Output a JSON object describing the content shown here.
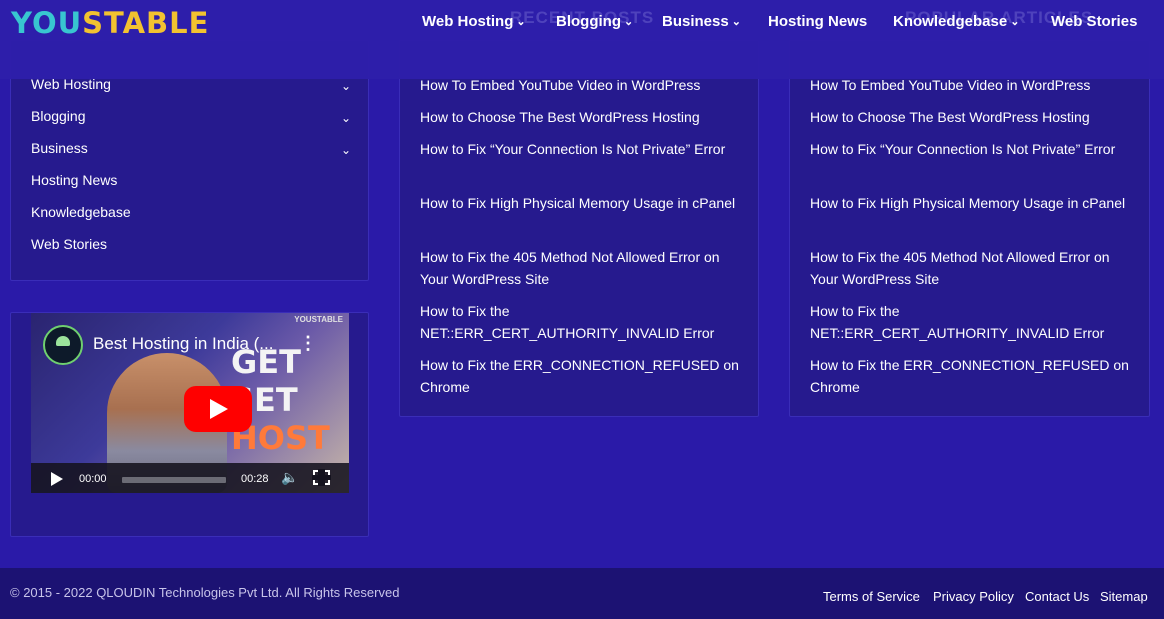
{
  "header": {
    "logo_part1": "YOU",
    "logo_part2": "STABLE",
    "ghost_recent": "RECENT POSTS",
    "ghost_popular": "POPULAR ARTICLES",
    "nav": [
      {
        "label": "Web Hosting",
        "has_dropdown": true
      },
      {
        "label": "Blogging",
        "has_dropdown": true
      },
      {
        "label": "Business",
        "has_dropdown": true
      },
      {
        "label": "Hosting News",
        "has_dropdown": false
      },
      {
        "label": "Knowledgebase",
        "has_dropdown": true
      },
      {
        "label": "Web Stories",
        "has_dropdown": false
      }
    ]
  },
  "categories": [
    {
      "label": "Web Hosting",
      "has_dropdown": true
    },
    {
      "label": "Blogging",
      "has_dropdown": true
    },
    {
      "label": "Business",
      "has_dropdown": true
    },
    {
      "label": "Hosting News",
      "has_dropdown": false
    },
    {
      "label": "Knowledgebase",
      "has_dropdown": false
    },
    {
      "label": "Web Stories",
      "has_dropdown": false
    }
  ],
  "video": {
    "title": "Best Hosting in India (...",
    "brand": "YOUSTABLE",
    "promo_line1": "GET",
    "promo_line2": "SET",
    "promo_line3": "HOST",
    "time_current": "00:00",
    "time_total": "00:28"
  },
  "recent_posts": [
    "How To Embed YouTube Video in WordPress",
    "How to Choose The Best WordPress Hosting",
    "How to Fix “Your Connection Is Not Private” Error",
    "How to Fix High Physical Memory Usage in cPanel",
    "How to Fix the 405 Method Not Allowed Error on Your WordPress Site",
    "How to Fix the NET::ERR_CERT_AUTHORITY_INVALID Error",
    "How to Fix the ERR_CONNECTION_REFUSED on Chrome"
  ],
  "popular_posts": [
    "How To Embed YouTube Video in WordPress",
    "How to Choose The Best WordPress Hosting",
    "How to Fix “Your Connection Is Not Private” Error",
    "How to Fix High Physical Memory Usage in cPanel",
    "How to Fix the 405 Method Not Allowed Error on Your WordPress Site",
    "How to Fix the NET::ERR_CERT_AUTHORITY_INVALID Error",
    "How to Fix the ERR_CONNECTION_REFUSED on Chrome"
  ],
  "footer": {
    "copyright": "© 2015 - 2022 QLOUDIN Technologies Pvt Ltd. All Rights Reserved",
    "links": [
      "Terms of Service",
      "Privacy Policy",
      "Contact Us",
      "Sitemap"
    ]
  },
  "colors": {
    "background": "#2a1aa8",
    "card": "#261a8e",
    "footer": "#1c1273",
    "logo_you": "#38c6d0",
    "logo_stable": "#f2c230",
    "youtube_red": "#ff0000"
  }
}
